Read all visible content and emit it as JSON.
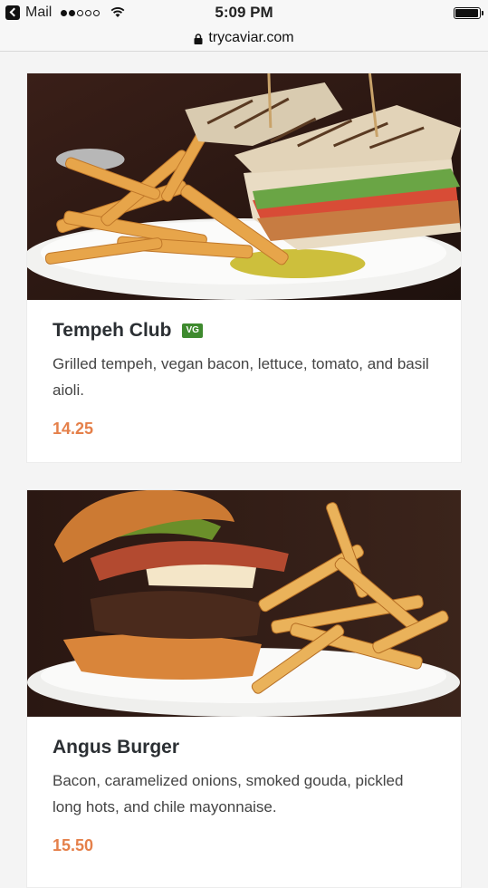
{
  "status_bar": {
    "back_app": "Mail",
    "time": "5:09 PM",
    "battery_level": 0.95
  },
  "url_bar": {
    "domain": "trycaviar.com"
  },
  "menu_items": [
    {
      "name": "Tempeh Club",
      "badge": "VG",
      "description": "Grilled tempeh, vegan bacon, lettuce, tomato, and basil aioli.",
      "price": "14.25"
    },
    {
      "name": "Angus Burger",
      "description": "Bacon, caramelized onions, smoked gouda, pickled long hots, and chile mayonnaise.",
      "price": "15.50"
    }
  ],
  "colors": {
    "price": "#e5804a",
    "badge": "#3e8a2e",
    "title": "#2b2f33"
  }
}
